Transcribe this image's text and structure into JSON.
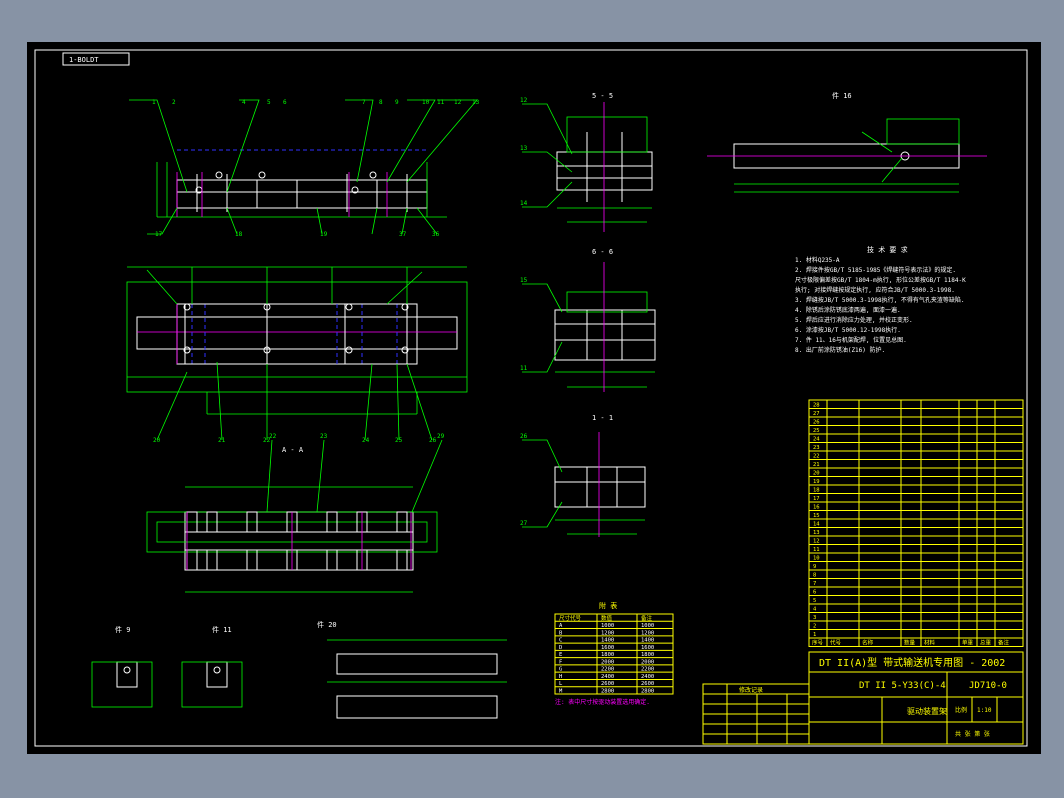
{
  "drawing": {
    "tag_label": "1-BOLDT",
    "section_labels": {
      "sec_5_5": "5 - 5",
      "sec_6_6": "6 - 6",
      "sec_1_1": "1 - 1",
      "view_a": "A - A",
      "part_16": "件 16",
      "part_9": "件 9",
      "part_11": "件 11",
      "part_20": "件 20",
      "scale": "1 : 10"
    },
    "tech_req_title": "技 术 要 求",
    "tech_requirements": [
      "1. 材料Q235-A",
      "2. 焊接件按GB/T 5185-1985《焊缝符号表示法》的规定.",
      "   尺寸极限偏差按GB/T 1804-m执行, 形位公差按GB/T 1184-K",
      "   执行; 对接焊缝按规定执行, 应符合JB/T 5000.3-1998.",
      "3. 焊缝按JB/T 5000.3-1998执行, 不得有气孔夹渣等缺陷.",
      "4. 除锈后涂防锈底漆两遍, 面漆一遍.",
      "5. 焊后应进行消除应力处理, 并校正变形.",
      "6. 涂漆按JB/T 5000.12-1998执行.",
      "7. 件 11、16与机架配焊, 位置见总图.",
      "8. 出厂前涂防锈油(Z16) 防护."
    ],
    "title_block": {
      "series_title": "DT II(A)型  带式输送机专用图 - 2002",
      "drawing_no": "DT II 5-Y33(C)-4",
      "code": "JD710-0",
      "part_name": "驱动装置架",
      "scale_label": "比例",
      "scale_value": "1:10",
      "sheet_label": "共 张  第 张"
    },
    "bom_rows": [
      "28",
      "27",
      "26",
      "25",
      "24",
      "23",
      "22",
      "21",
      "20",
      "19",
      "18",
      "17",
      "16",
      "15",
      "14",
      "13",
      "12",
      "11",
      "10",
      "9",
      "8",
      "7",
      "6",
      "5",
      "4",
      "3",
      "2",
      "1"
    ],
    "bom_header": [
      "序号",
      "代号",
      "名称",
      "数量",
      "材料",
      "单重",
      "总重",
      "备注"
    ],
    "table_title": "附 表",
    "small_table": {
      "headers": [
        "尺寸代号",
        "数值",
        "备注"
      ],
      "rows": [
        [
          "A",
          "1000",
          "1000"
        ],
        [
          "B",
          "1200",
          "1200"
        ],
        [
          "C",
          "1400",
          "1400"
        ],
        [
          "D",
          "1600",
          "1600"
        ],
        [
          "E",
          "1800",
          "1800"
        ],
        [
          "F",
          "2000",
          "2000"
        ],
        [
          "G",
          "2200",
          "2200"
        ],
        [
          "H",
          "2400",
          "2400"
        ],
        [
          "L",
          "2600",
          "2600"
        ],
        [
          "M",
          "2800",
          "2800"
        ]
      ],
      "note": "注: 表中尺寸按驱动装置选用确定."
    },
    "rev_block_title": "修改记录",
    "leader_numbers": [
      "1",
      "2",
      "3",
      "4",
      "5",
      "6",
      "7",
      "8",
      "9",
      "10",
      "11",
      "12",
      "13",
      "14",
      "15",
      "16",
      "17",
      "18",
      "19",
      "20",
      "21",
      "22",
      "23",
      "24",
      "25",
      "26",
      "27",
      "28"
    ]
  }
}
